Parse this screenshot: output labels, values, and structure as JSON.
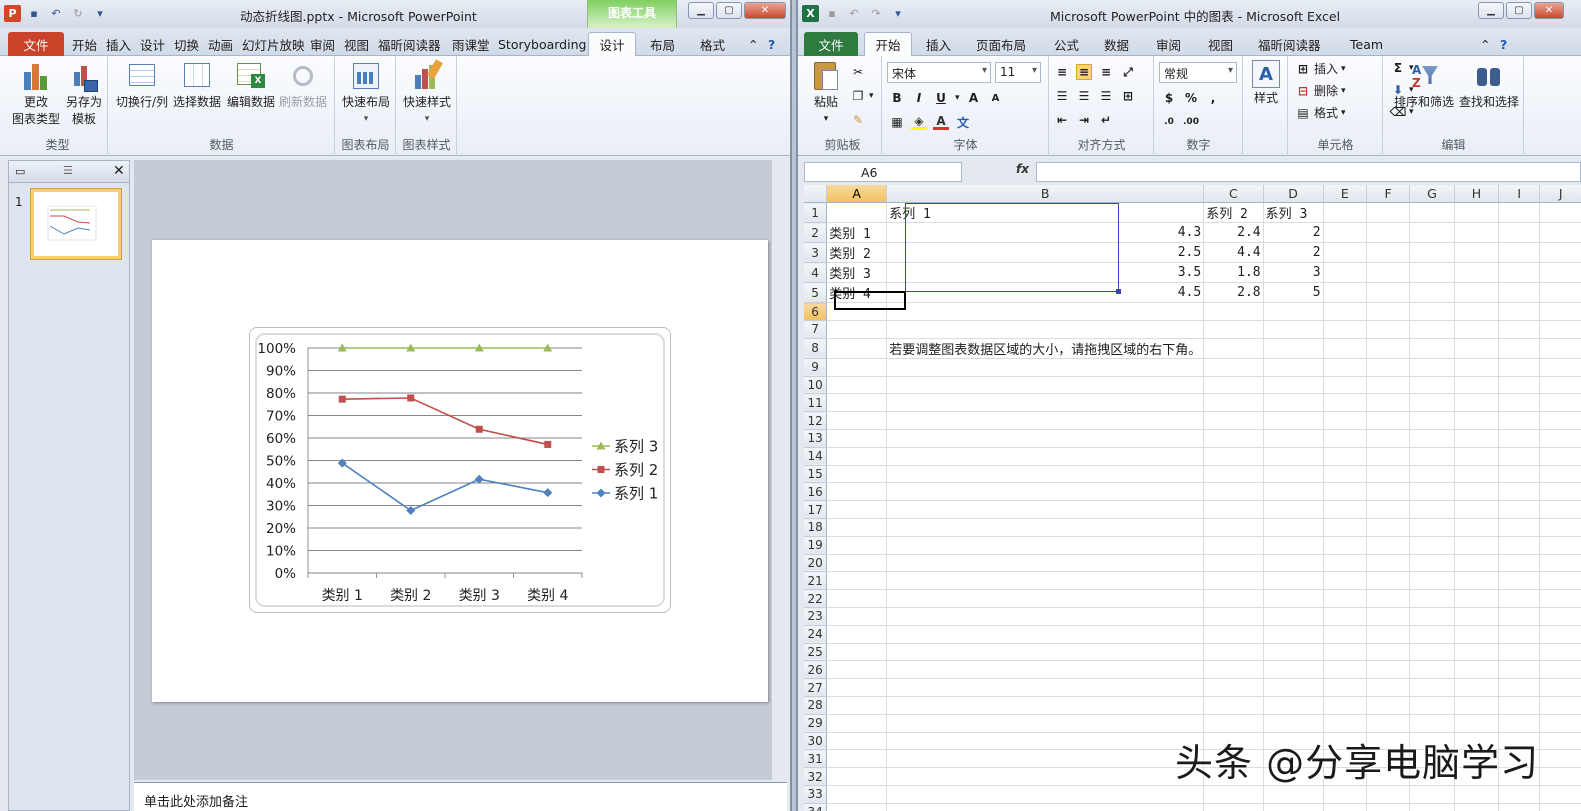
{
  "ppt": {
    "title": "动态折线图.pptx - Microsoft PowerPoint",
    "context_group": "图表工具",
    "tabs": [
      "文件",
      "开始",
      "插入",
      "设计",
      "切换",
      "动画",
      "幻灯片放映",
      "审阅",
      "视图",
      "福昕阅读器",
      "雨课堂",
      "Storyboarding",
      "设计",
      "布局",
      "格式"
    ],
    "ribbon": {
      "type_group": "类型",
      "change_type": "更改\n图表类型",
      "save_template": "另存为\n模板",
      "data_group": "数据",
      "switch_rowcol": "切换行/列",
      "select_data": "选择数据",
      "edit_data": "编辑数据",
      "refresh_data": "刷新数据",
      "layout_group": "图表布局",
      "quick_layout": "快速布局",
      "style_group": "图表样式",
      "quick_style": "快速样式"
    },
    "slide_number": "1",
    "notes_placeholder": "单击此处添加备注"
  },
  "chart_data": {
    "type": "line",
    "categories": [
      "类别 1",
      "类别 2",
      "类别 3",
      "类别 4"
    ],
    "y_ticks": [
      "100%",
      "90%",
      "80%",
      "70%",
      "60%",
      "50%",
      "40%",
      "30%",
      "20%",
      "10%",
      "0%"
    ],
    "ylim": [
      0,
      1
    ],
    "grid": true,
    "legend_position": "right",
    "series": [
      {
        "name": "系列 1",
        "color": "#4f81bd",
        "marker": "diamond",
        "values": [
          0.4886,
          0.2778,
          0.4167,
          0.3571
        ]
      },
      {
        "name": "系列 2",
        "color": "#c0504d",
        "marker": "square",
        "values": [
          0.7727,
          0.7778,
          0.6389,
          0.5714
        ]
      },
      {
        "name": "系列 3",
        "color": "#9bbb59",
        "marker": "triangle",
        "values": [
          1.0,
          1.0,
          1.0,
          1.0
        ]
      }
    ]
  },
  "excel": {
    "title": "Microsoft PowerPoint 中的图表 - Microsoft Excel",
    "tabs": [
      "文件",
      "开始",
      "插入",
      "页面布局",
      "公式",
      "数据",
      "审阅",
      "视图",
      "福昕阅读器",
      "Team"
    ],
    "font_name": "宋体",
    "font_size": "11",
    "number_format": "常规",
    "paste": "粘贴",
    "styles": "样式",
    "insert": "插入",
    "delete": "删除",
    "format": "格式",
    "sort_filter": "排序和筛选",
    "find_select": "查找和选择",
    "groups": [
      "剪贴板",
      "字体",
      "对齐方式",
      "数字",
      "单元格",
      "编辑"
    ],
    "name_box": "A6",
    "fx": "fx",
    "columns": [
      "A",
      "B",
      "C",
      "D",
      "E",
      "F",
      "G",
      "H",
      "I",
      "J"
    ],
    "rows": [
      [
        "",
        "系列 1",
        "系列 2",
        "系列 3"
      ],
      [
        "类别 1",
        "4.3",
        "2.4",
        "2"
      ],
      [
        "类别 2",
        "2.5",
        "4.4",
        "2"
      ],
      [
        "类别 3",
        "3.5",
        "1.8",
        "3"
      ],
      [
        "类别 4",
        "4.5",
        "2.8",
        "5"
      ]
    ],
    "hint_row": 8,
    "hint_text": "若要调整图表数据区域的大小，请拖拽区域的右下角。",
    "row_count": 34
  },
  "watermark": "头条 @分享电脑学习"
}
